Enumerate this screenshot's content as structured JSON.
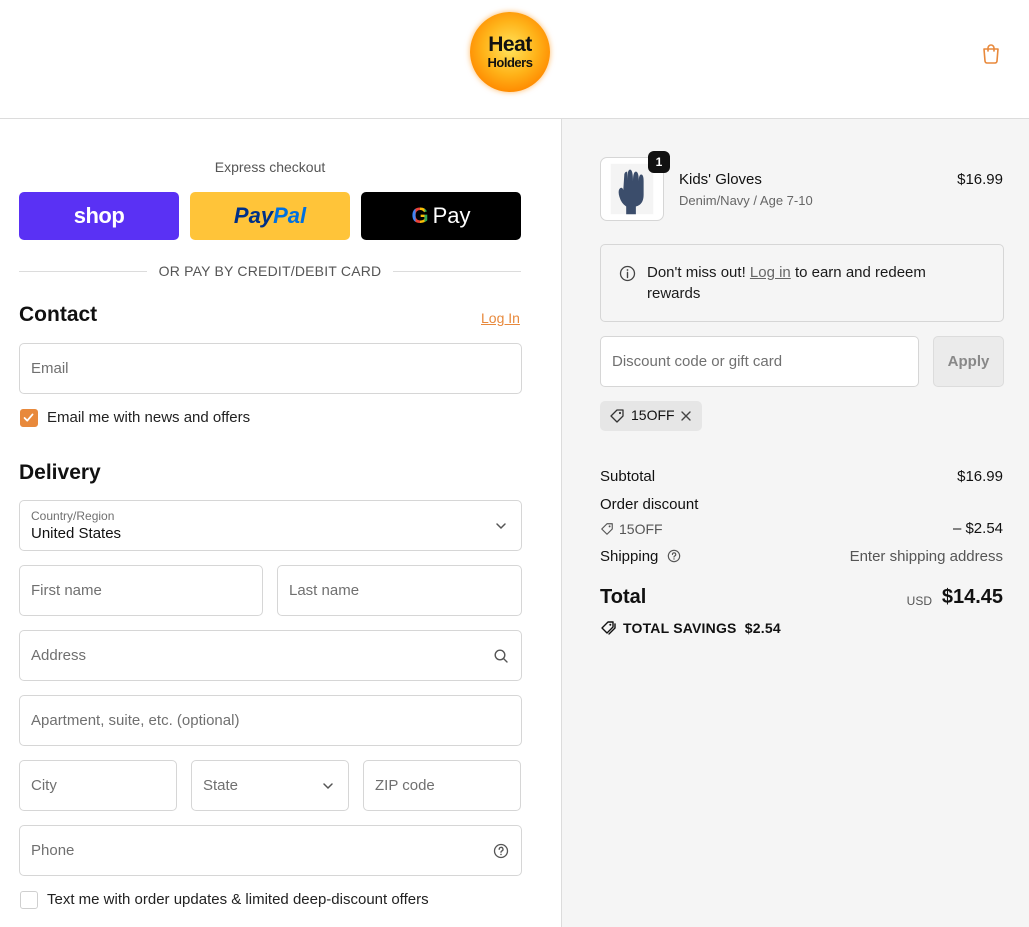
{
  "header": {
    "logo_line1": "Heat",
    "logo_line2": "Holders",
    "cart_icon": "shopping-bag-icon"
  },
  "express": {
    "title": "Express checkout",
    "shop_label": "shop",
    "paypal_label_1": "Pay",
    "paypal_label_2": "Pal",
    "gpay_g": "G",
    "gpay_label": "Pay",
    "divider_text": "OR PAY BY CREDIT/DEBIT CARD"
  },
  "contact": {
    "title": "Contact",
    "login_link": "Log In",
    "email_placeholder": "Email",
    "newsletter_label": "Email me with news and offers",
    "newsletter_checked": true
  },
  "delivery": {
    "title": "Delivery",
    "country_label": "Country/Region",
    "country_value": "United States",
    "first_name_placeholder": "First name",
    "last_name_placeholder": "Last name",
    "address_placeholder": "Address",
    "apartment_placeholder": "Apartment, suite, etc. (optional)",
    "city_placeholder": "City",
    "state_placeholder": "State",
    "zip_placeholder": "ZIP code",
    "phone_placeholder": "Phone",
    "sms_label": "Text me with order updates & limited deep-discount offers",
    "sms_checked": false
  },
  "cart": {
    "item": {
      "quantity": "1",
      "name": "Kids' Gloves",
      "variant": "Denim/Navy / Age 7-10",
      "price": "$16.99"
    },
    "notice": {
      "prefix": "Don't miss out! ",
      "link": "Log in",
      "suffix": " to earn and redeem rewards"
    },
    "discount_placeholder": "Discount code or gift card",
    "apply_label": "Apply",
    "applied_code": "15OFF"
  },
  "summary": {
    "subtotal_label": "Subtotal",
    "subtotal_value": "$16.99",
    "order_discount_label": "Order discount",
    "discount_code": "15OFF",
    "discount_value": "– $2.54",
    "shipping_label": "Shipping",
    "shipping_value": "Enter shipping address",
    "total_label": "Total",
    "currency": "USD",
    "total_value": "$14.45",
    "savings_label": "TOTAL SAVINGS",
    "savings_value": "$2.54"
  },
  "colors": {
    "accent": "#e8893c",
    "shop_pay": "#5a31f4",
    "paypal": "#ffc439",
    "gpay": "#000000"
  }
}
